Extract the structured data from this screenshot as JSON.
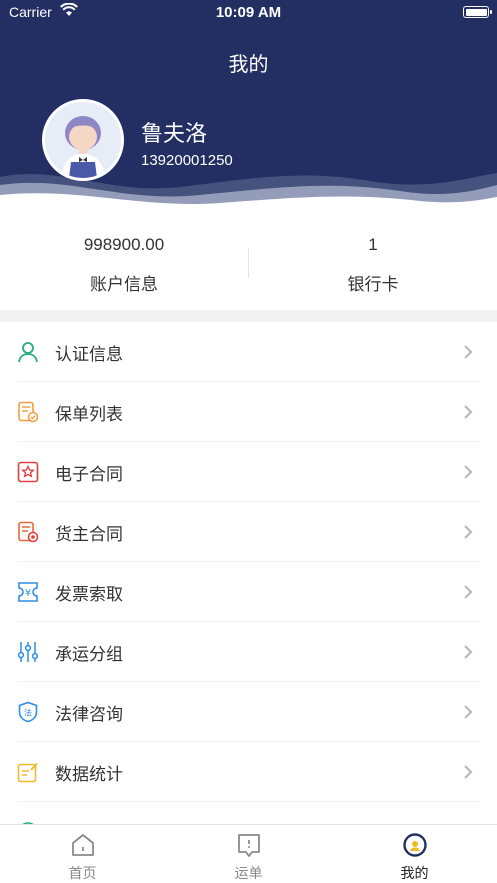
{
  "status_bar": {
    "carrier": "Carrier",
    "time": "10:09 AM"
  },
  "header": {
    "title": "我的"
  },
  "user": {
    "name": "鲁夫洛",
    "phone": "13920001250"
  },
  "stats": [
    {
      "value": "998900.00",
      "label": "账户信息"
    },
    {
      "value": "1",
      "label": "银行卡"
    }
  ],
  "menu": [
    {
      "label": "认证信息",
      "icon": "user-icon"
    },
    {
      "label": "保单列表",
      "icon": "policy-list-icon"
    },
    {
      "label": "电子合同",
      "icon": "e-contract-icon"
    },
    {
      "label": "货主合同",
      "icon": "shipper-contract-icon"
    },
    {
      "label": "发票索取",
      "icon": "invoice-icon"
    },
    {
      "label": "承运分组",
      "icon": "sliders-icon"
    },
    {
      "label": "法律咨询",
      "icon": "law-shield-icon"
    },
    {
      "label": "数据统计",
      "icon": "statistics-icon"
    }
  ],
  "tabs": [
    {
      "label": "首页",
      "icon": "home-icon"
    },
    {
      "label": "运单",
      "icon": "waybill-icon"
    },
    {
      "label": "我的",
      "icon": "profile-icon"
    }
  ],
  "colors": {
    "header_bg": "#232f63",
    "icon_green": "#21b07a",
    "icon_orange": "#f0a040",
    "icon_red": "#e23c3c",
    "icon_blue": "#2e8de6",
    "icon_yellow": "#f2b92a"
  }
}
